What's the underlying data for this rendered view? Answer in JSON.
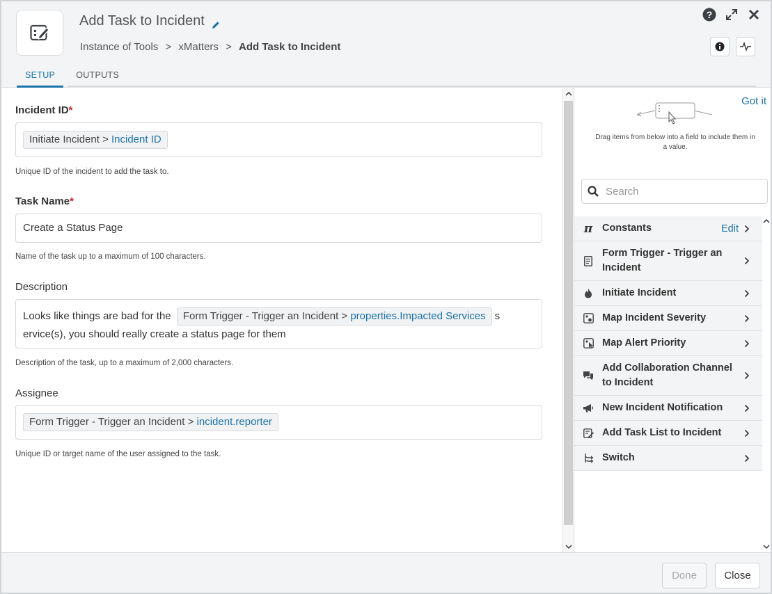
{
  "header": {
    "title": "Add Task to Incident",
    "breadcrumb": {
      "root": "Instance of Tools",
      "sep1": ">",
      "middle": "xMatters",
      "sep2": ">",
      "current": "Add Task to Incident"
    },
    "tabs": [
      {
        "label": "SETUP",
        "active": true
      },
      {
        "label": "OUTPUTS",
        "active": false
      }
    ]
  },
  "form": {
    "incident_id": {
      "label": "Incident ID",
      "required_mark": "*",
      "pill_prefix": "Initiate Incident >",
      "pill_value": "Incident ID",
      "help": "Unique ID of the incident to add the task to."
    },
    "task_name": {
      "label": "Task Name",
      "required_mark": "*",
      "value": "Create a Status Page",
      "help": "Name of the task up to a maximum of 100 characters."
    },
    "description": {
      "label": "Description",
      "text_before": "Looks like things are bad for the",
      "pill_prefix": "Form Trigger - Trigger an Incident >",
      "pill_value": "properties.Impacted Services",
      "text_after_1": "s",
      "text_after_2": "ervice(s), you should really create a status page for them",
      "help": "Description of the task, up to a maximum of 2,000 characters."
    },
    "assignee": {
      "label": "Assignee",
      "pill_prefix": "Form Trigger - Trigger an Incident >",
      "pill_value": "incident.reporter",
      "help": "Unique ID or target name of the user assigned to the task."
    }
  },
  "side": {
    "got_it": "Got it",
    "drag_hint": "Drag items from below into a field to include them in a value.",
    "search_placeholder": "Search",
    "items": [
      {
        "label": "Constants",
        "edit": "Edit",
        "icon": "pi-icon"
      },
      {
        "label": "Form Trigger - Trigger an Incident",
        "icon": "form-icon"
      },
      {
        "label": "Initiate Incident",
        "icon": "fire-icon"
      },
      {
        "label": "Map Incident Severity",
        "icon": "map-icon"
      },
      {
        "label": "Map Alert Priority",
        "icon": "map-alert-icon"
      },
      {
        "label": "Add Collaboration Channel to Incident",
        "icon": "chat-icon"
      },
      {
        "label": "New Incident Notification",
        "icon": "megaphone-icon"
      },
      {
        "label": "Add Task List to Incident",
        "icon": "task-list-icon"
      },
      {
        "label": "Switch",
        "icon": "switch-icon"
      }
    ]
  },
  "footer": {
    "done": "Done",
    "close": "Close"
  }
}
